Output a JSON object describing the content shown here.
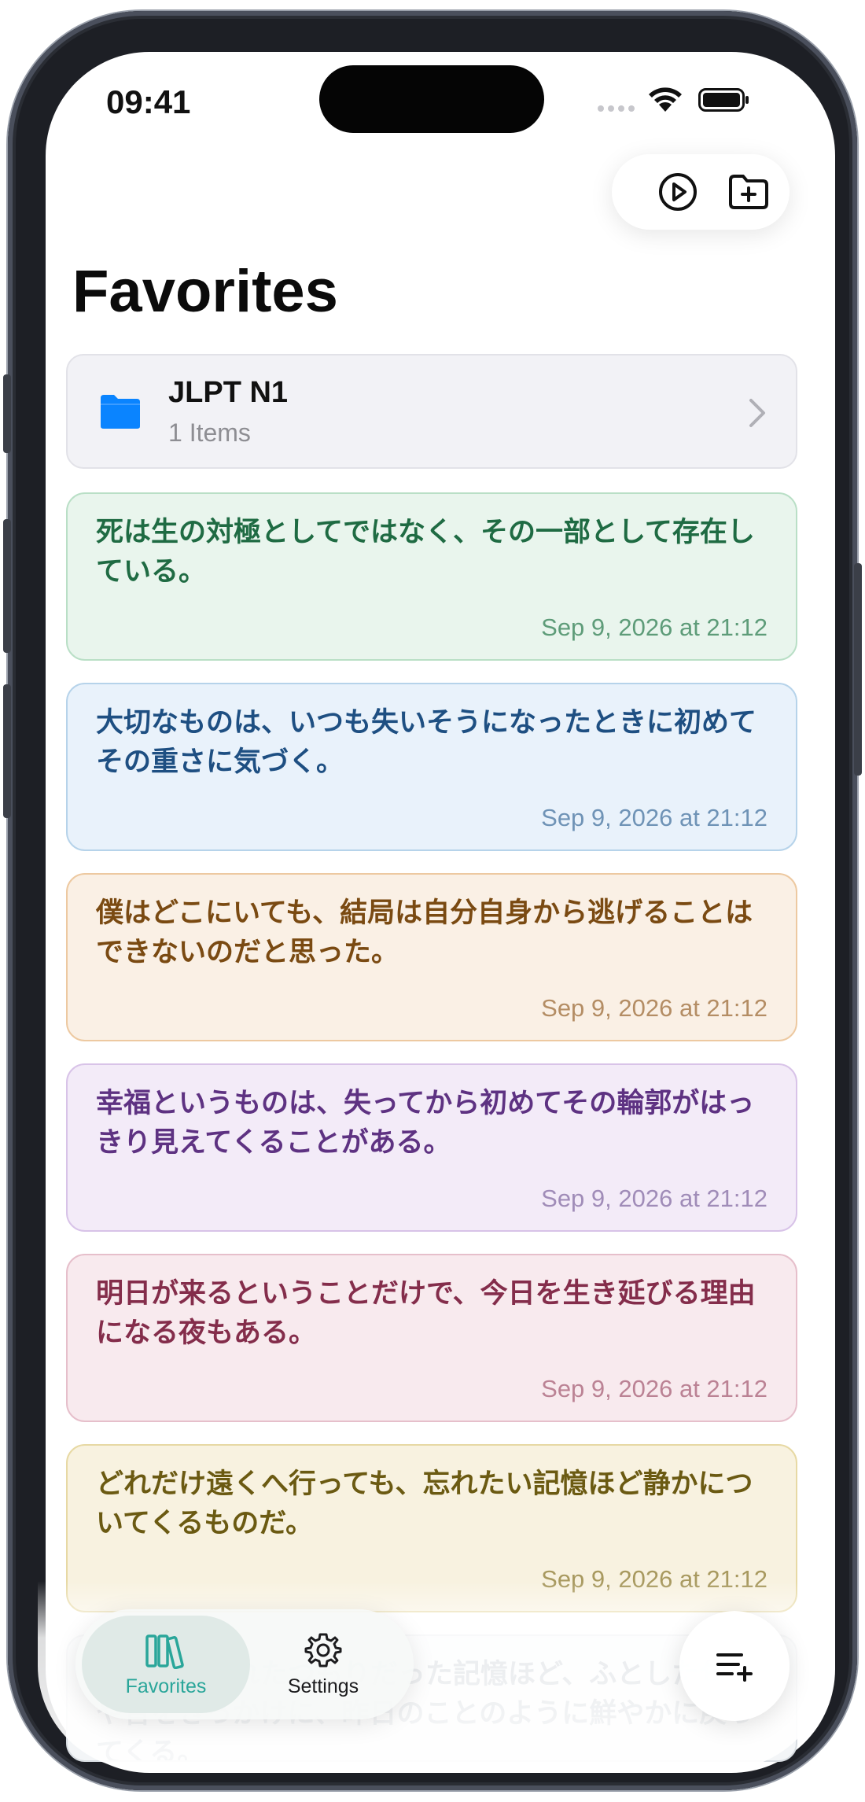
{
  "status_bar": {
    "time": "09:41"
  },
  "toolbar": {
    "play_icon": "play-circle-icon",
    "new_folder_icon": "folder-plus-icon"
  },
  "page": {
    "title": "Favorites"
  },
  "folder": {
    "name": "JLPT N1",
    "count": "1 Items",
    "icon": "folder-icon",
    "color": "#0a84ff"
  },
  "cards": [
    {
      "text": "死は生の対極としてではなく、その一部として存在している。",
      "date": "Sep 9, 2026 at 21:12",
      "text_color": "#1f6b43",
      "date_color": "#5e9c79",
      "bg": "#e9f5ed",
      "border": "#b9dfc6"
    },
    {
      "text": "大切なものは、いつも失いそうになったときに初めてその重さに気づく。",
      "date": "Sep 9, 2026 at 21:12",
      "text_color": "#1e4f82",
      "date_color": "#6f93b6",
      "bg": "#e9f2fb",
      "border": "#b6d3ea"
    },
    {
      "text": "僕はどこにいても、結局は自分自身から逃げることはできないのだと思った。",
      "date": "Sep 9, 2026 at 21:12",
      "text_color": "#7a4a12",
      "date_color": "#b48d64",
      "bg": "#faf0e5",
      "border": "#edc9a1"
    },
    {
      "text": "幸福というものは、失ってから初めてその輪郭がはっきり見えてくることがある。",
      "date": "Sep 9, 2026 at 21:12",
      "text_color": "#5e3282",
      "date_color": "#a08cb8",
      "bg": "#f3ebf8",
      "border": "#d8c3e8"
    },
    {
      "text": "明日が来るということだけで、今日を生き延びる理由になる夜もある。",
      "date": "Sep 9, 2026 at 21:12",
      "text_color": "#842d4b",
      "date_color": "#bb8294",
      "bg": "#f8eaee",
      "border": "#e6bfcb"
    },
    {
      "text": "どれだけ遠くへ行っても、忘れたい記憶ほど静かについてくるものだ。",
      "date": "Sep 9, 2026 at 21:12",
      "text_color": "#6b5a12",
      "date_color": "#a8995f",
      "bg": "#f8f2e0",
      "border": "#e7d9a4"
    },
    {
      "text": "とっくに忘れたつもりだった記憶ほど、ふとした匂いや音をきっかけに、昨日のことのように鮮やかに戻ってくる。",
      "date": "",
      "text_color": "#6a7a8a",
      "date_color": "#a0a8b0",
      "bg": "#f3f5f7",
      "border": "#d8dde2"
    }
  ],
  "tabs": [
    {
      "label": "Favorites",
      "icon": "books-icon",
      "active": true,
      "color": "#2aa69a"
    },
    {
      "label": "Settings",
      "icon": "gear-icon",
      "active": false,
      "color": "#1c1c1e"
    }
  ],
  "fab": {
    "icon": "add-to-list-icon"
  }
}
